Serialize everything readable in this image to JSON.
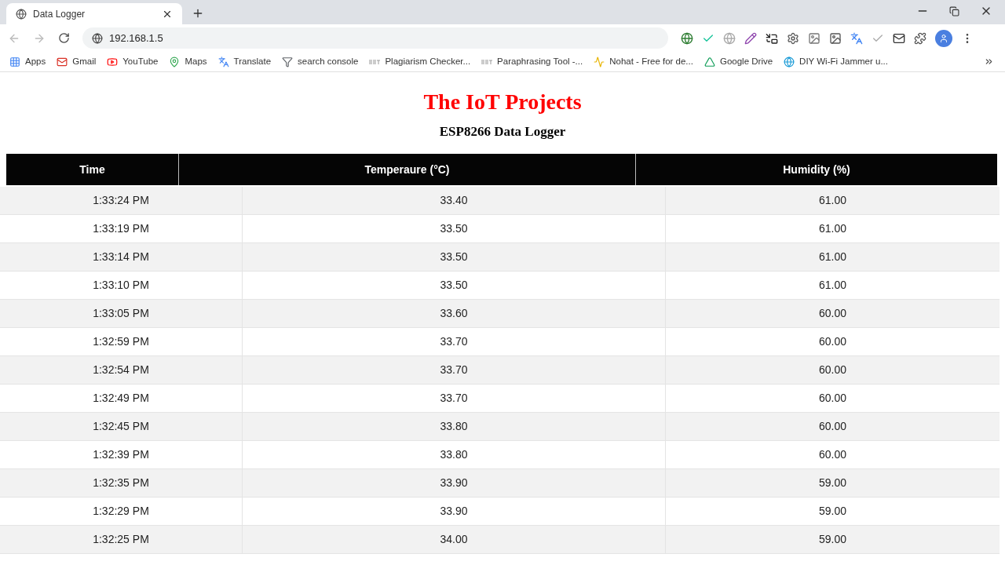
{
  "browser": {
    "tab": {
      "title": "Data Logger",
      "selected": true
    },
    "address": "192.168.1.5",
    "bookmarks": [
      {
        "label": "Apps",
        "kind": "apps"
      },
      {
        "label": "Gmail",
        "kind": "mail"
      },
      {
        "label": "YouTube",
        "kind": "video"
      },
      {
        "label": "Maps",
        "kind": "pin"
      },
      {
        "label": "Translate",
        "kind": "translate"
      },
      {
        "label": "search console",
        "kind": "console"
      },
      {
        "label": "Plagiarism Checker...",
        "kind": "sst"
      },
      {
        "label": "Paraphrasing Tool -...",
        "kind": "sst"
      },
      {
        "label": "Nohat - Free for de...",
        "kind": "pulse"
      },
      {
        "label": "Google Drive",
        "kind": "drive"
      },
      {
        "label": "DIY Wi-Fi Jammer u...",
        "kind": "globe"
      }
    ]
  },
  "page": {
    "title": "The IoT Projects",
    "subtitle": "ESP8266 Data Logger",
    "table": {
      "columns": [
        "Time",
        "Temperaure (°C)",
        "Humidity (%)"
      ],
      "rows": [
        [
          "1:33:24 PM",
          "33.40",
          "61.00"
        ],
        [
          "1:33:19 PM",
          "33.50",
          "61.00"
        ],
        [
          "1:33:14 PM",
          "33.50",
          "61.00"
        ],
        [
          "1:33:10 PM",
          "33.50",
          "61.00"
        ],
        [
          "1:33:05 PM",
          "33.60",
          "60.00"
        ],
        [
          "1:32:59 PM",
          "33.70",
          "60.00"
        ],
        [
          "1:32:54 PM",
          "33.70",
          "60.00"
        ],
        [
          "1:32:49 PM",
          "33.70",
          "60.00"
        ],
        [
          "1:32:45 PM",
          "33.80",
          "60.00"
        ],
        [
          "1:32:39 PM",
          "33.80",
          "60.00"
        ],
        [
          "1:32:35 PM",
          "33.90",
          "59.00"
        ],
        [
          "1:32:29 PM",
          "33.90",
          "59.00"
        ],
        [
          "1:32:25 PM",
          "34.00",
          "59.00"
        ]
      ]
    }
  }
}
